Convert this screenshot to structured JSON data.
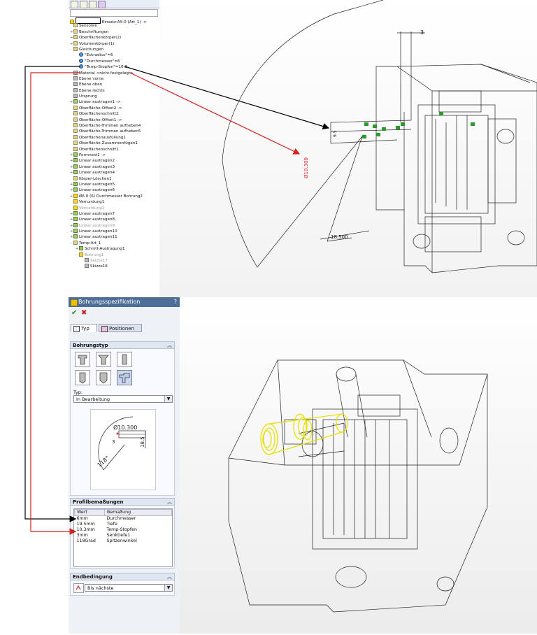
{
  "tree": {
    "part_name": "Einsatz-AS-0 (Art_1) ->",
    "items": [
      {
        "label": "Sensoren",
        "pm": "",
        "icon": "sensor-icon",
        "indent": 1
      },
      {
        "label": "Beschriftungen",
        "pm": "+",
        "icon": "annotations-icon",
        "indent": 1
      },
      {
        "label": "Oberflächenkörper(2)",
        "pm": "+",
        "icon": "surface-bodies-icon",
        "indent": 1
      },
      {
        "label": "Volumenkörper(1)",
        "pm": "+",
        "icon": "solid-bodies-icon",
        "indent": 1
      },
      {
        "label": "Gleichungen",
        "pm": "-",
        "icon": "equations-icon",
        "indent": 1
      },
      {
        "label": "\"Eckradius\"=6",
        "pm": "",
        "icon": "global-variable-icon",
        "indent": 2
      },
      {
        "label": "\"Durchmesser\"=6",
        "pm": "",
        "icon": "global-variable-icon",
        "indent": 2
      },
      {
        "label": "\"Temp-Stopfen\"=10.3",
        "pm": "",
        "icon": "global-variable-icon",
        "indent": 2
      },
      {
        "label": "Material <nicht festgelegt>",
        "pm": "",
        "icon": "material-icon",
        "indent": 1
      },
      {
        "label": "Ebene vorne",
        "pm": "",
        "icon": "plane-icon",
        "indent": 1
      },
      {
        "label": "Ebene oben",
        "pm": "",
        "icon": "plane-icon",
        "indent": 1
      },
      {
        "label": "Ebene rechts",
        "pm": "",
        "icon": "plane-icon",
        "indent": 1
      },
      {
        "label": "Ursprung",
        "pm": "",
        "icon": "origin-icon",
        "indent": 1
      },
      {
        "label": "Linear austragen1 ->",
        "pm": "+",
        "icon": "extrude-icon",
        "indent": 1
      },
      {
        "label": "Oberfläche-Offset2 ->",
        "pm": "",
        "icon": "surface-offset-icon",
        "indent": 1
      },
      {
        "label": "Oberflächenschnitt2",
        "pm": "",
        "icon": "surface-cut-icon",
        "indent": 1
      },
      {
        "label": "Oberfläche-Offset1 ->",
        "pm": "",
        "icon": "surface-offset-icon",
        "indent": 1
      },
      {
        "label": "Oberfläche-Trimmen aufheben4",
        "pm": "",
        "icon": "untrim-icon",
        "indent": 1
      },
      {
        "label": "Oberfläche-Trimmen aufheben5",
        "pm": "",
        "icon": "untrim-icon",
        "indent": 1
      },
      {
        "label": "Oberflächenausfüllung1",
        "pm": "",
        "icon": "fill-surface-icon",
        "indent": 1
      },
      {
        "label": "Oberfläche-Zusammenfügen1",
        "pm": "",
        "icon": "knit-surface-icon",
        "indent": 1
      },
      {
        "label": "Oberflächenschnitt1",
        "pm": "",
        "icon": "surface-cut-icon",
        "indent": 1
      },
      {
        "label": "Formnest1 ->",
        "pm": "+",
        "icon": "cavity-icon",
        "indent": 1
      },
      {
        "label": "Linear austragen2",
        "pm": "+",
        "icon": "extrude-icon",
        "indent": 1
      },
      {
        "label": "Linear austragen3",
        "pm": "+",
        "icon": "extrude-icon",
        "indent": 1
      },
      {
        "label": "Linear austragen4",
        "pm": "+",
        "icon": "extrude-icon",
        "indent": 1
      },
      {
        "label": "Körper-Löschen1",
        "pm": "",
        "icon": "delete-body-icon",
        "indent": 1
      },
      {
        "label": "Linear austragen5",
        "pm": "+",
        "icon": "extrude-icon",
        "indent": 1
      },
      {
        "label": "Linear austragen6",
        "pm": "+",
        "icon": "extrude-icon",
        "indent": 1
      },
      {
        "label": "Ø6.0 (6) Durchmesser Bohrung2",
        "pm": "+",
        "icon": "hole-icon",
        "indent": 1
      },
      {
        "label": "Verrundung1",
        "pm": "",
        "icon": "fillet-icon",
        "indent": 1
      },
      {
        "label": "Verrundung2",
        "pm": "",
        "icon": "fillet-icon",
        "indent": 1,
        "gray": true
      },
      {
        "label": "Linear austragen7",
        "pm": "+",
        "icon": "extrude-icon",
        "indent": 1
      },
      {
        "label": "Linear austragen8",
        "pm": "+",
        "icon": "extrude-icon",
        "indent": 1
      },
      {
        "label": "Linear austragen9",
        "pm": "+",
        "icon": "extrude-icon",
        "indent": 1,
        "gray": true
      },
      {
        "label": "Linear austragen10",
        "pm": "+",
        "icon": "extrude-icon",
        "indent": 1
      },
      {
        "label": "Linear austragen11",
        "pm": "+",
        "icon": "extrude-icon",
        "indent": 1
      },
      {
        "label": "Temp-Art_1",
        "pm": "-",
        "icon": "folder-icon",
        "indent": 1
      },
      {
        "label": "Schnitt-Austragung1",
        "pm": "+",
        "icon": "cut-extrude-icon",
        "indent": 2
      },
      {
        "label": "Bohrung1",
        "pm": "-",
        "icon": "hole-icon",
        "indent": 2,
        "gray": true
      },
      {
        "label": "Skizze17",
        "pm": "",
        "icon": "sketch-icon",
        "indent": 3,
        "gray": true
      },
      {
        "label": "Skizze16",
        "pm": "",
        "icon": "sketch-icon",
        "indent": 3
      }
    ]
  },
  "viewport_top": {
    "dim_3": "3",
    "dim_10300": "Ø10.300",
    "dim_9_5": "9.5",
    "dim_18500": "18.500"
  },
  "pm": {
    "title": "Bohrungsspezifikation",
    "help": "?",
    "ok_glyph": "✔",
    "cancel_glyph": "✖",
    "tabs": [
      "Typ",
      "Positionen"
    ],
    "hole_type_title": "Bohrungstyp",
    "type_label": "Typ:",
    "type_value": "In Bearbeitung",
    "preview": {
      "dia": "Ø10.300",
      "depth": "18.5",
      "small": "3",
      "angle": "118°"
    },
    "profile_title": "Profilbemaßungen",
    "profile_headers": [
      "Wert",
      "Bemaßung"
    ],
    "profile_rows": [
      [
        "6mm",
        "Durchmesser"
      ],
      [
        "19.5mm",
        "Tiefe"
      ],
      [
        "10.3mm",
        "Temp-Stopfen"
      ],
      [
        "3mm",
        "Senktiefe1"
      ],
      [
        "118Grad",
        "Spitzenwinkel"
      ]
    ],
    "end_title": "Endbedingung",
    "end_value": "Bis nächste"
  },
  "colors": {
    "arrow_black": "#000000",
    "arrow_red": "#d42020",
    "highlight_yellow": "#e8e000",
    "pm_title_bg": "#4d6e97"
  }
}
